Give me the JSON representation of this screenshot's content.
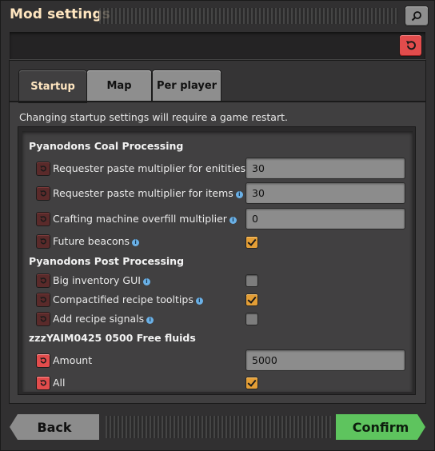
{
  "window": {
    "title": "Mod settings"
  },
  "tabs": [
    {
      "label": "Startup",
      "active": true
    },
    {
      "label": "Map",
      "active": false
    },
    {
      "label": "Per player",
      "active": false
    }
  ],
  "notice": "Changing startup settings will require a game restart.",
  "sections": [
    {
      "title": "Pyanodons Coal Processing",
      "rows": [
        {
          "label": "Requester paste multiplier for enitities",
          "type": "text",
          "value": "30",
          "has_info": true,
          "reset_active": false
        },
        {
          "label": "Requester paste multiplier for items",
          "type": "text",
          "value": "30",
          "has_info": true,
          "reset_active": false
        },
        {
          "label": "Crafting machine overfill multiplier",
          "type": "text",
          "value": "0",
          "has_info": true,
          "reset_active": false
        },
        {
          "label": "Future beacons",
          "type": "checkbox",
          "checked": true,
          "has_info": true,
          "reset_active": false
        }
      ]
    },
    {
      "title": "Pyanodons Post Processing",
      "rows": [
        {
          "label": "Big inventory GUI",
          "type": "checkbox",
          "checked": false,
          "has_info": true,
          "reset_active": false
        },
        {
          "label": "Compactified recipe tooltips",
          "type": "checkbox",
          "checked": true,
          "has_info": true,
          "reset_active": false
        },
        {
          "label": "Add recipe signals",
          "type": "checkbox",
          "checked": false,
          "has_info": true,
          "reset_active": false
        }
      ]
    },
    {
      "title": "zzzYAIM0425 0500 Free fluids",
      "rows": [
        {
          "label": "Amount",
          "type": "text",
          "value": "5000",
          "has_info": false,
          "reset_active": true
        },
        {
          "label": "All",
          "type": "checkbox",
          "checked": true,
          "has_info": false,
          "reset_active": true
        }
      ]
    }
  ],
  "buttons": {
    "back": "Back",
    "confirm": "Confirm"
  },
  "icons": {
    "search": "search-icon",
    "reset": "reset-icon",
    "info": "info-icon"
  },
  "colors": {
    "title": "#ffe6c0",
    "reset_active": "#e24c4c",
    "reset_inactive": "#5a2a2a",
    "checkbox_checked": "#e39e36",
    "confirm": "#5ec45e"
  }
}
